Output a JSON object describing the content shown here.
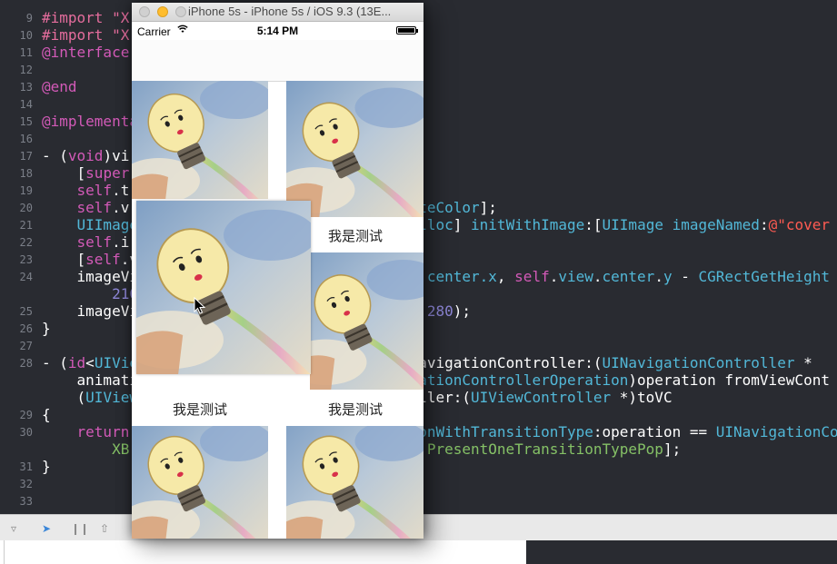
{
  "editor": {
    "lines": [
      {
        "n": "9",
        "html": "<span class='pp'>#import \"X</span>"
      },
      {
        "n": "10",
        "html": "<span class='pp'>#import \"X</span>"
      },
      {
        "n": "11",
        "html": "<span class='kw'>@interface</span>"
      },
      {
        "n": "12",
        "html": ""
      },
      {
        "n": "13",
        "html": "<span class='kw'>@end</span>"
      },
      {
        "n": "14",
        "html": ""
      },
      {
        "n": "15",
        "html": "<span class='kw'>@implementa</span>"
      },
      {
        "n": "16",
        "html": ""
      },
      {
        "n": "17",
        "html": "- (<span class='kw'>void</span>)vi"
      },
      {
        "n": "18",
        "html": "    [<span class='kw'>super</span>"
      },
      {
        "n": "19",
        "html": "    <span class='kw'>self</span>.t"
      },
      {
        "n": "20",
        "html": "    <span class='kw'>self</span>.v                                <span class='ty'>iteColor</span>];"
      },
      {
        "n": "21",
        "html": "    <span class='ty'>UIImage</span>                               <span class='ty'>alloc</span>] <span class='ty'>initWithImage</span>:[<span class='ty'>UIImage</span> <span class='ty'>imageNamed</span>:<span class='st'>@\"cover</span>"
      },
      {
        "n": "22",
        "html": "    <span class='kw'>self</span>.i"
      },
      {
        "n": "23",
        "html": "    [<span class='kw'>self</span>.v"
      },
      {
        "n": "24",
        "html": "    imageVi                               <span class='ty'>w.center.x</span>, <span class='kw'>self</span>.<span class='ty'>view</span>.<span class='ty'>center</span>.<span class='ty'>y</span> - <span class='ty'>CGRectGetHeight</span>"
      },
      {
        "n": "",
        "html": "        <span class='nm'>210</span>"
      },
      {
        "n": "25",
        "html": "    imageVi                               , <span class='nm'>280</span>);"
      },
      {
        "n": "26",
        "html": "}"
      },
      {
        "n": "27",
        "html": ""
      },
      {
        "n": "28",
        "html": "- (<span class='kw'>id</span>&lt;<span class='ty'>UIVie</span>                             &gt;)navigationController:(<span class='ty'>UINavigationController</span> *"
      },
      {
        "n": "",
        "html": "    animati                               <span class='ty'>gationControllerOperation</span>)operation fromViewCont"
      },
      {
        "n": "",
        "html": "    (<span class='ty'>UIView</span>                                ller:(<span class='ty'>UIViewController</span> *)toVC"
      },
      {
        "n": "29",
        "html": "{"
      },
      {
        "n": "30",
        "html": "    <span class='kw'>return</span>                                 <span class='ty'>onWithTransitionType</span>:operation == <span class='ty'>UINavigationCo</span>"
      },
      {
        "n": "",
        "html": "        <span class='gr'>XB</span>                                  <span class='gr'>PresentOneTransitionTypePop</span>];"
      },
      {
        "n": "31",
        "html": "}"
      },
      {
        "n": "32",
        "html": ""
      },
      {
        "n": "33",
        "html": ""
      }
    ]
  },
  "simulator": {
    "title": "iPhone 5s - iPhone 5s / iOS 9.3 (13E...",
    "status": {
      "carrier": "Carrier",
      "wifi": "wifi-icon",
      "time": "5:14 PM"
    },
    "captions": [
      "我是测试",
      "我是测试",
      "我是测试"
    ]
  },
  "colors": {
    "editor_bg": "#292b31",
    "close": "#ff5f57",
    "minimize": "#ffbd2e",
    "zoom": "#d0d0d0"
  }
}
